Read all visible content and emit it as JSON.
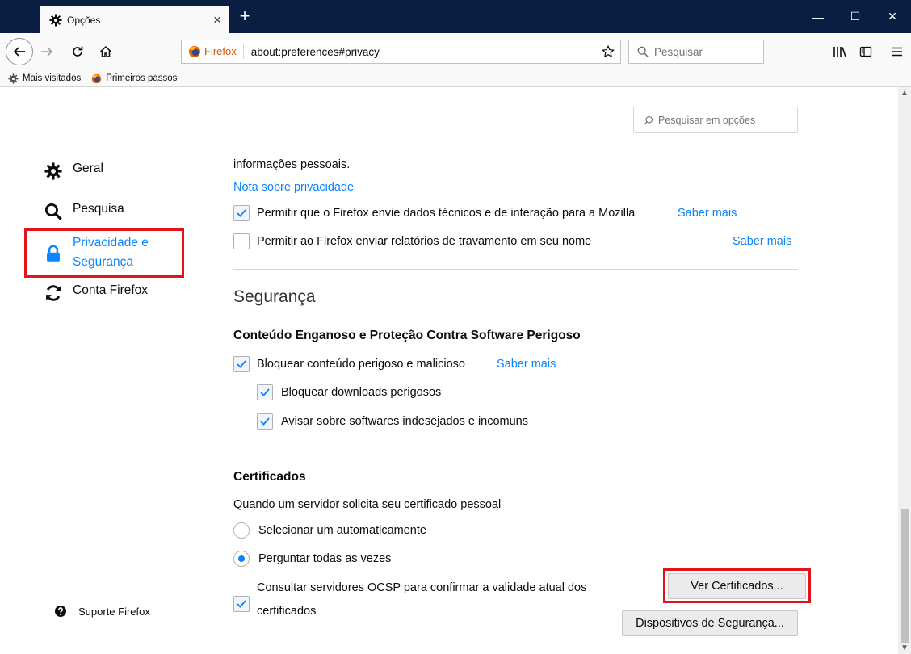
{
  "browser": {
    "tab_title": "Opções",
    "new_tab_symbol": "+",
    "tab_close_symbol": "×",
    "window": {
      "minimize": "—",
      "maximize": "☐",
      "close": "✕"
    },
    "identity_label": "Firefox",
    "url": "about:preferences#privacy",
    "search_placeholder": "Pesquisar",
    "bookmarks": [
      {
        "label": "Mais visitados",
        "icon": "gear-icon"
      },
      {
        "label": "Primeiros passos",
        "icon": "firefox-icon"
      }
    ]
  },
  "options_search_placeholder": "Pesquisar em opções",
  "sidebar": {
    "items": [
      {
        "label": "Geral",
        "icon": "gear-icon"
      },
      {
        "label": "Pesquisa",
        "icon": "search-icon"
      },
      {
        "label_line1": "Privacidade e",
        "label_line2": "Segurança",
        "icon": "lock-icon",
        "selected": true
      },
      {
        "label": "Conta Firefox",
        "icon": "sync-icon"
      }
    ],
    "support_label": "Suporte Firefox"
  },
  "data_collection": {
    "intro_tail": "informações pessoais.",
    "privacy_notice_link": "Nota sobre privacidade",
    "telemetry_label": "Permitir que o Firefox envie dados técnicos e de interação para a Mozilla",
    "telemetry_checked": true,
    "telemetry_learn_more": "Saber mais",
    "crash_label": "Permitir ao Firefox enviar relatórios de travamento em seu nome",
    "crash_checked": false,
    "crash_learn_more": "Saber mais"
  },
  "security": {
    "title": "Segurança",
    "deceptive_heading": "Conteúdo Enganoso e Proteção Contra Software Perigoso",
    "block_dangerous_label": "Bloquear conteúdo perigoso e malicioso",
    "block_dangerous_learn_more": "Saber mais",
    "block_downloads_label": "Bloquear downloads perigosos",
    "warn_unwanted_label": "Avisar sobre softwares indesejados e incomuns",
    "certificates_heading": "Certificados",
    "cert_request_label": "Quando um servidor solicita seu certificado pessoal",
    "select_auto_label": "Selecionar um automaticamente",
    "ask_every_time_label": "Perguntar todas as vezes",
    "ocsp_label_line1": "Consultar servidores OCSP para confirmar a validade atual dos",
    "ocsp_label_line2": "certificados",
    "view_certs_button": "Ver Certificados...",
    "security_devices_button": "Dispositivos de Segurança..."
  },
  "colors": {
    "accent": "#0a84ff",
    "highlight": "#e2141b",
    "titlebar": "#0a1e42"
  }
}
